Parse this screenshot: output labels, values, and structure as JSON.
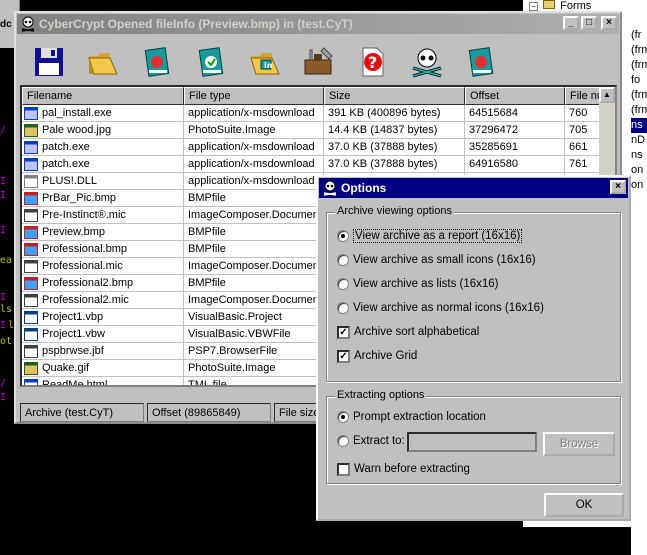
{
  "main_window": {
    "title": "CyberCrypt Opened fileInfo (Preview.bmp) in (test.CyT)",
    "buttons": {
      "minimize": "_",
      "maximize": "□",
      "close": "×"
    },
    "toolbar": [
      "floppy-disk-icon",
      "folder-open-icon",
      "book-red-icon",
      "book-green-icon",
      "folder-in-icon",
      "tools-icon",
      "help-icon",
      "skull-icon",
      "book-cyan-icon"
    ],
    "columns": [
      "Filename",
      "File type",
      "Size",
      "Offset",
      "File number"
    ],
    "rows": [
      {
        "name": "pal_install.exe",
        "type": "application/x-msdownload",
        "size": "391 KB  (400896 bytes)",
        "offset": "64515684",
        "num": "760"
      },
      {
        "name": "Pale wood.jpg",
        "type": "PhotoSuite.Image",
        "size": "14.4 KB  (14837 bytes)",
        "offset": "37296472",
        "num": "705"
      },
      {
        "name": "patch.exe",
        "type": "application/x-msdownload",
        "size": "37.0 KB  (37888 bytes)",
        "offset": "35285691",
        "num": "661"
      },
      {
        "name": "patch.exe",
        "type": "application/x-msdownload",
        "size": "37.0 KB  (37888 bytes)",
        "offset": "64916580",
        "num": "761"
      },
      {
        "name": "PLUS!.DLL",
        "type": "application/x-msdownload",
        "size": "",
        "offset": "",
        "num": ""
      },
      {
        "name": "PrBar_Pic.bmp",
        "type": "BMPfile",
        "size": "",
        "offset": "",
        "num": ""
      },
      {
        "name": "Pre-Instinct®.mic",
        "type": "ImageComposer.Document",
        "size": "",
        "offset": "",
        "num": ""
      },
      {
        "name": "Preview.bmp",
        "type": "BMPfile",
        "size": "",
        "offset": "",
        "num": ""
      },
      {
        "name": "Professional.bmp",
        "type": "BMPfile",
        "size": "",
        "offset": "",
        "num": ""
      },
      {
        "name": "Professional.mic",
        "type": "ImageComposer.Document",
        "size": "",
        "offset": "",
        "num": ""
      },
      {
        "name": "Professional2.bmp",
        "type": "BMPfile",
        "size": "",
        "offset": "",
        "num": ""
      },
      {
        "name": "Professional2.mic",
        "type": "ImageComposer.Document",
        "size": "",
        "offset": "",
        "num": ""
      },
      {
        "name": "Project1.vbp",
        "type": "VisualBasic.Project",
        "size": "",
        "offset": "",
        "num": ""
      },
      {
        "name": "Project1.vbw",
        "type": "VisualBasic.VBWFile",
        "size": "",
        "offset": "",
        "num": ""
      },
      {
        "name": "pspbrwse.jbf",
        "type": "PSP7.BrowserFile",
        "size": "",
        "offset": "",
        "num": ""
      },
      {
        "name": "Quake.gif",
        "type": "PhotoSuite.Image",
        "size": "",
        "offset": "",
        "num": ""
      },
      {
        "name": "ReadMe.html",
        "type": "TML file",
        "size": "",
        "offset": "",
        "num": ""
      }
    ],
    "status": [
      "Archive (test.CyT)",
      "Offset (89865849)",
      "File size"
    ]
  },
  "options_dialog": {
    "title": "Options",
    "close": "×",
    "viewing": {
      "legend": "Archive viewing options",
      "report": "View archive as a report (16x16)",
      "small": "View archive as small icons (16x16)",
      "lists": "View archive as lists (16x16)",
      "normal": "View archive as normal icons (16x16)",
      "sort": "Archive sort alphabetical",
      "grid": "Archive Grid"
    },
    "extracting": {
      "legend": "Extracting options",
      "prompt": "Prompt extraction location",
      "extract_to": "Extract to:",
      "extract_to_value": "",
      "browse": "Browse",
      "warn": "Warn before extracting"
    },
    "ok": "OK"
  },
  "background_right": {
    "tree_label": "Forms",
    "fragments": [
      "(fr",
      "(frm",
      "(frm",
      "fo",
      "(frm",
      "(frm",
      "ns",
      "nD",
      "ns",
      "on (",
      "on (fo"
    ]
  },
  "background_left": {
    "tab_label": "dc (",
    "fragments": [
      "/",
      "I",
      "I",
      "I",
      "ea",
      "I",
      "ls",
      "I",
      "ls",
      "ot",
      "/",
      "I",
      "Lo"
    ]
  }
}
